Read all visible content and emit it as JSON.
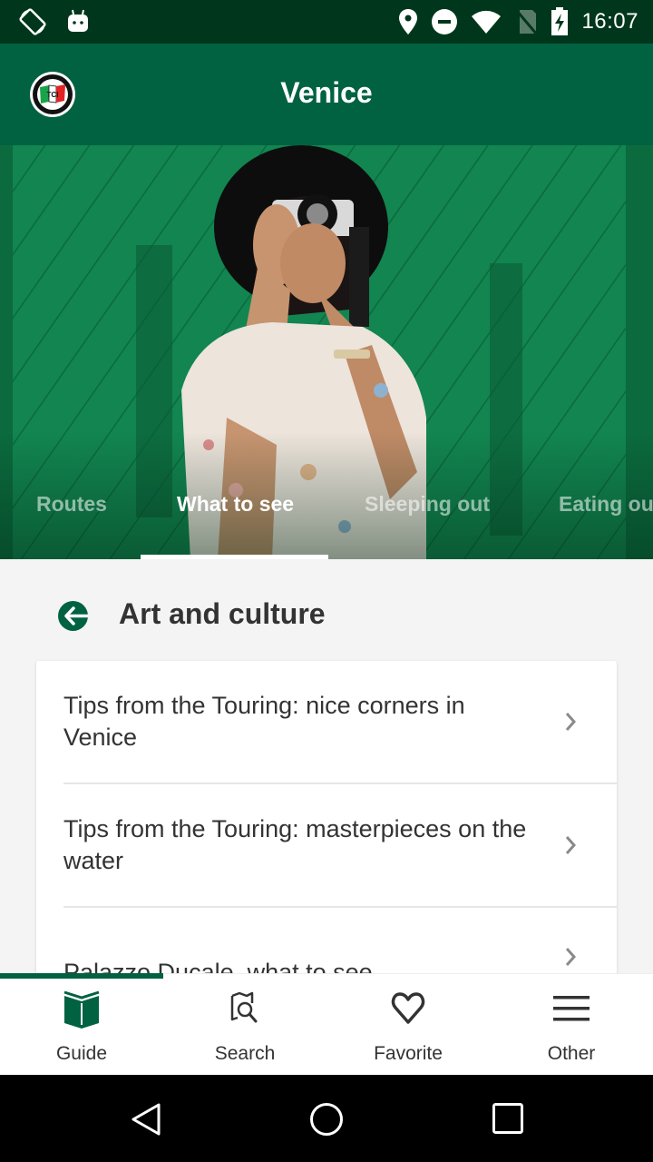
{
  "status_bar": {
    "time": "16:07",
    "left_icons": [
      "screen-rotation-icon",
      "android-debug-icon"
    ],
    "right_icons": [
      "location-icon",
      "do-not-disturb-icon",
      "wifi-icon",
      "no-sim-icon",
      "battery-charging-icon"
    ]
  },
  "app_bar": {
    "title": "Venice",
    "logo": "touring-club-logo"
  },
  "tabs": [
    {
      "label": "Routes",
      "active": false
    },
    {
      "label": "What to see",
      "active": true
    },
    {
      "label": "Sleeping out",
      "active": false
    },
    {
      "label": "Eating out",
      "active": false
    }
  ],
  "section": {
    "title": "Art and culture",
    "back_icon": "arrow-back-icon"
  },
  "list": [
    {
      "text": "Tips from the Touring: nice corners in Venice"
    },
    {
      "text": "Tips from the Touring: masterpieces on the water"
    },
    {
      "text": "Palazzo Ducale, what to see"
    }
  ],
  "bottom_nav": [
    {
      "label": "Guide",
      "icon": "book-icon",
      "active": true
    },
    {
      "label": "Search",
      "icon": "map-search-icon",
      "active": false
    },
    {
      "label": "Favorite",
      "icon": "heart-icon",
      "active": false
    },
    {
      "label": "Other",
      "icon": "menu-icon",
      "active": false
    }
  ],
  "colors": {
    "primary": "#006241",
    "status_bar": "#00371c",
    "text": "#333333"
  }
}
